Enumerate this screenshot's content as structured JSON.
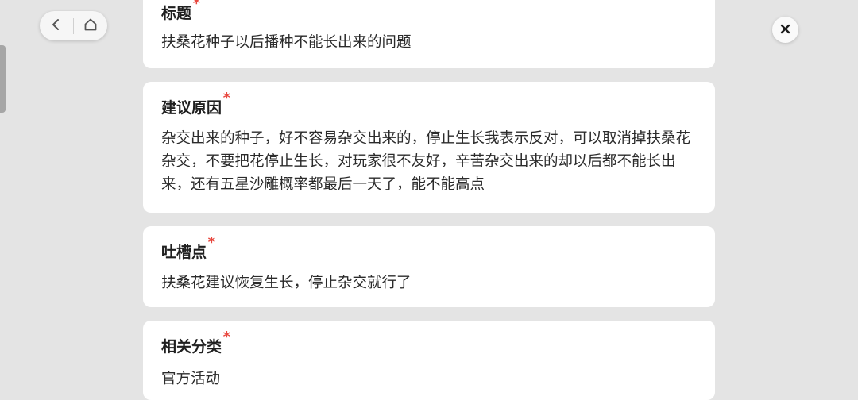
{
  "nav": {
    "back_icon": "chevron-left-icon",
    "home_icon": "home-icon"
  },
  "close_icon": "close-icon",
  "cards": [
    {
      "title": "标题",
      "required_mark": "*",
      "value": "扶桑花种子以后播种不能长出来的问题"
    },
    {
      "title": "建议原因",
      "required_mark": "*",
      "value": "杂交出来的种子，好不容易杂交出来的，停止生长我表示反对，可以取消掉扶桑花杂交，不要把花停止生长，对玩家很不友好，辛苦杂交出来的却以后都不能长出来，还有五星沙雕概率都最后一天了，能不能高点"
    },
    {
      "title": "吐槽点",
      "required_mark": "*",
      "value": "扶桑花建议恢复生长，停止杂交就行了"
    },
    {
      "title": "相关分类",
      "required_mark": "*",
      "value": "官方活动"
    }
  ],
  "colors": {
    "background": "#e4e4e4",
    "card": "#ffffff",
    "required": "#e8473e"
  }
}
